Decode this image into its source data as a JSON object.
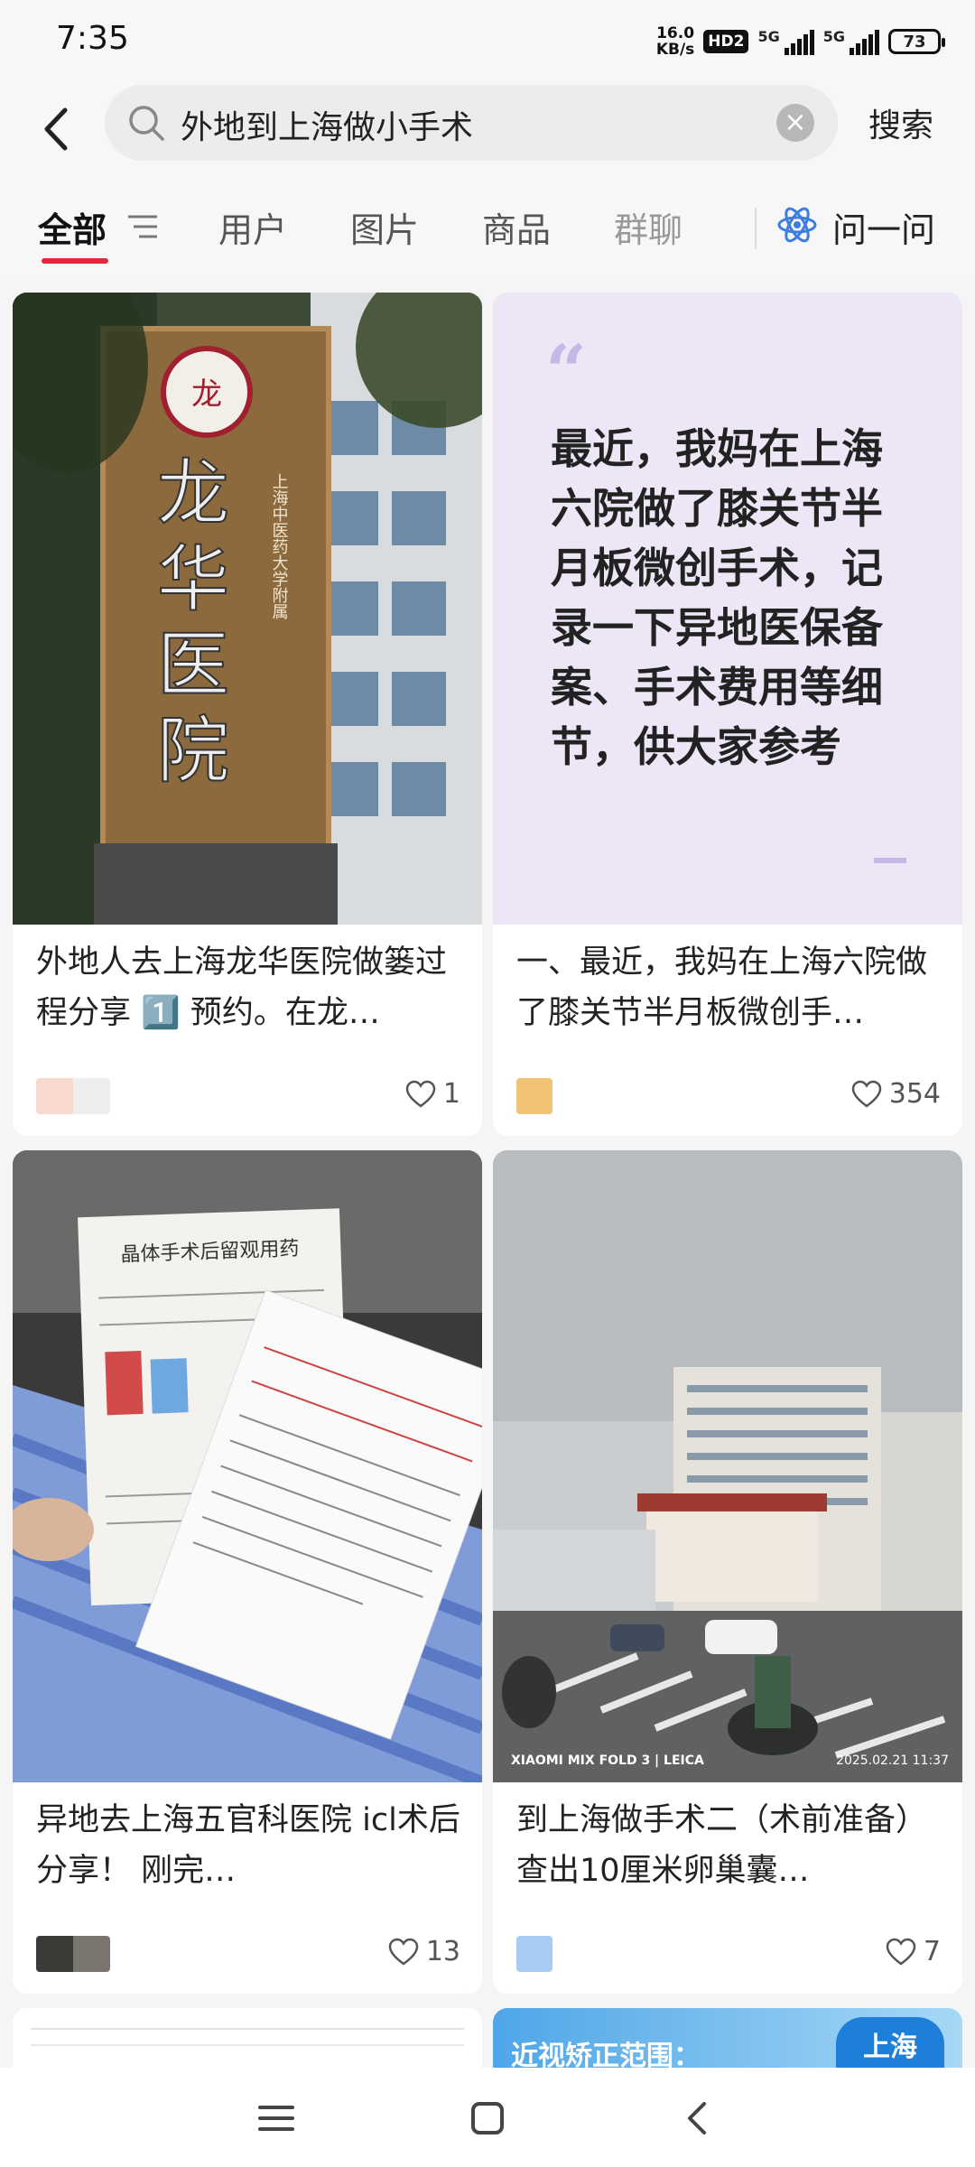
{
  "status": {
    "time": "7:35",
    "net_speed_value": "16.0",
    "net_speed_unit": "KB/s",
    "hd_badge": "HD2",
    "sim1": "5G",
    "sim2": "5G",
    "battery": "73"
  },
  "search": {
    "query": "外地到上海做小手术",
    "submit_label": "搜索"
  },
  "tabs": {
    "all": "全部",
    "users": "用户",
    "images": "图片",
    "products": "商品",
    "groups": "群聊",
    "ask": "问一问"
  },
  "cards": [
    {
      "title": "外地人去上海龙华医院做篓过程分享 1️⃣ 预约。在龙…",
      "likes": "1",
      "image_sign_text": "龙华医院",
      "image_sign_sub": "上海中医药大学附属"
    },
    {
      "title": "一、最近，我妈在上海六院做了膝关节半月板微创手…",
      "likes": "354",
      "quote_text": "最近，我妈在上海六院做了膝关节半月板微创手术，记录一下异地医保备案、手术费用等细节，供大家参考"
    },
    {
      "title": "异地去上海五官科医院 icl术后分享！ 刚完…",
      "likes": "13",
      "doc_heading": "晶体手术后留观用药"
    },
    {
      "title": "到上海做手术二（术前准备）查出10厘米卵巢囊…",
      "likes": "7",
      "watermark_left": "XIAOMI MIX FOLD 3 | LEICA",
      "watermark_right": "2025.02.21 11:37"
    }
  ],
  "bottom_cards": {
    "right_caption": "近视矫正范围：",
    "right_badge": "上海"
  },
  "colors": {
    "accent": "#e3283b",
    "quote_bg": "#ece6f6",
    "highlight": "#9be36a"
  }
}
